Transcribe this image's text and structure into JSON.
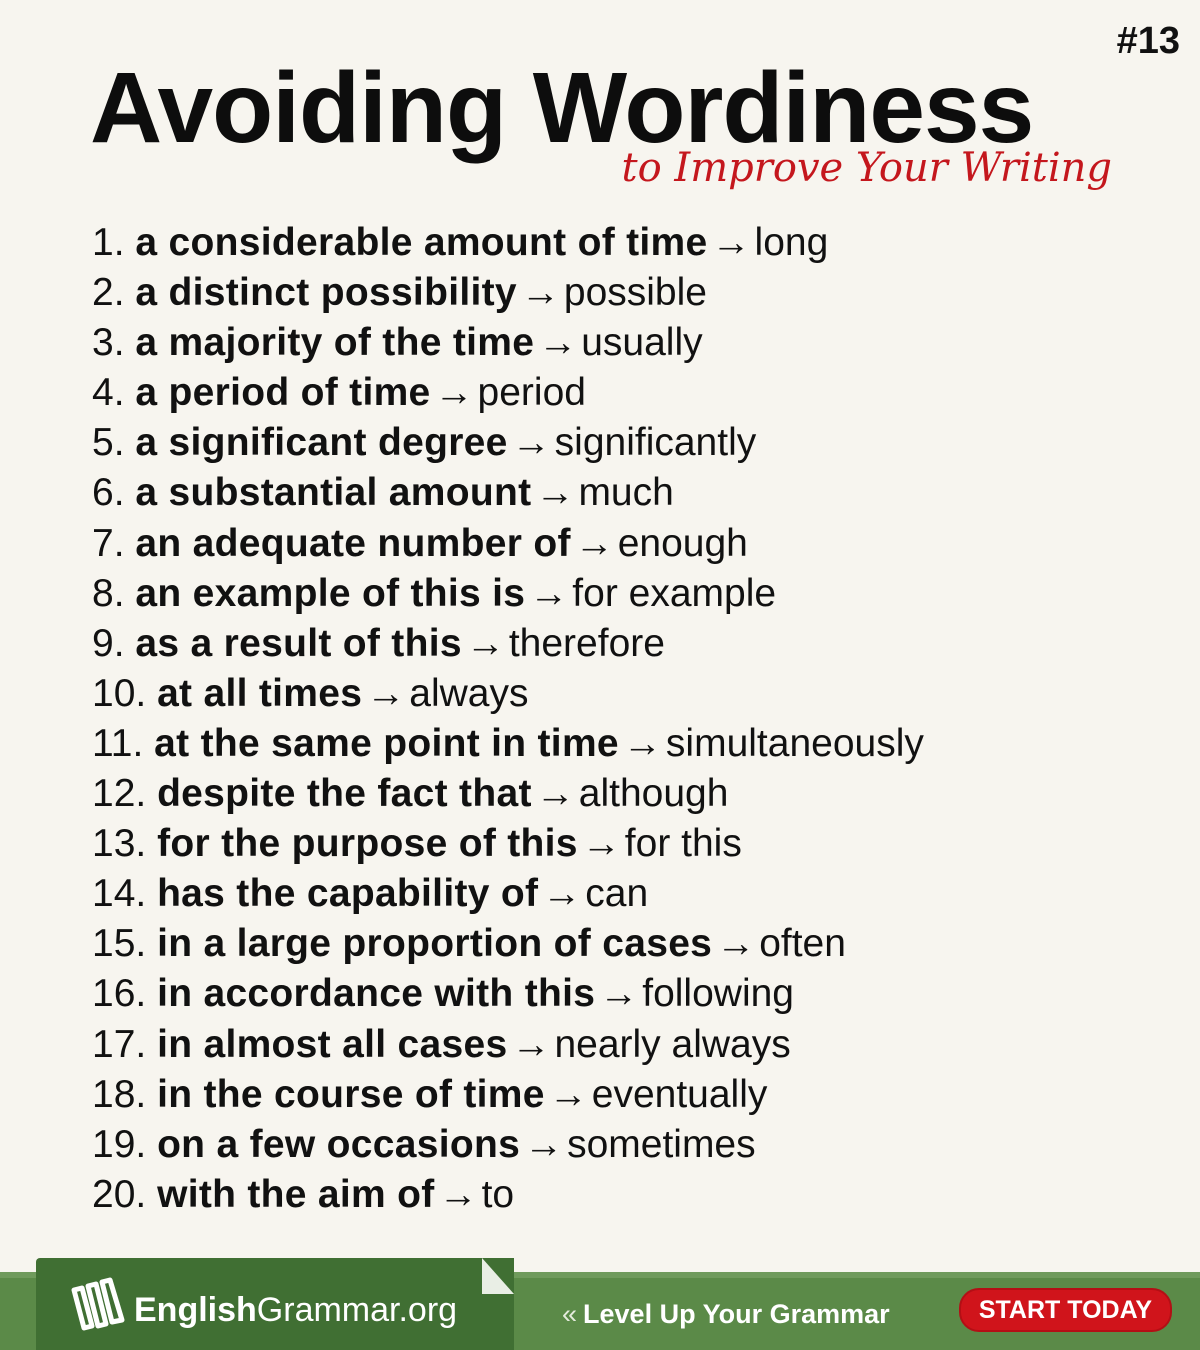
{
  "header": {
    "badge": "#13",
    "title": "Avoiding Wordiness",
    "subtitle": "to Improve Your Writing"
  },
  "arrow_symbol": "→",
  "items": [
    {
      "number": "1.",
      "phrase": "a considerable amount of time",
      "replacement": "long"
    },
    {
      "number": "2.",
      "phrase": "a distinct possibility",
      "replacement": "possible"
    },
    {
      "number": "3.",
      "phrase": "a majority of the time",
      "replacement": "usually"
    },
    {
      "number": "4.",
      "phrase": "a period of time",
      "replacement": "period"
    },
    {
      "number": "5.",
      "phrase": "a significant degree",
      "replacement": "significantly"
    },
    {
      "number": "6.",
      "phrase": "a substantial amount",
      "replacement": "much"
    },
    {
      "number": "7.",
      "phrase": "an adequate number of",
      "replacement": "enough"
    },
    {
      "number": "8.",
      "phrase": "an example of this is",
      "replacement": "for example"
    },
    {
      "number": "9.",
      "phrase": "as a result of this",
      "replacement": "therefore"
    },
    {
      "number": "10.",
      "phrase": "at all times",
      "replacement": "always"
    },
    {
      "number": "11.",
      "phrase": "at the same point in time",
      "replacement": "simultaneously"
    },
    {
      "number": "12.",
      "phrase": "despite the fact that",
      "replacement": "although"
    },
    {
      "number": "13.",
      "phrase": "for the purpose of this",
      "replacement": "for this"
    },
    {
      "number": "14.",
      "phrase": "has the capability of",
      "replacement": "can"
    },
    {
      "number": "15.",
      "phrase": "in a large proportion of cases",
      "replacement": "often"
    },
    {
      "number": "16.",
      "phrase": "in accordance with this",
      "replacement": "following"
    },
    {
      "number": "17.",
      "phrase": "in almost all cases",
      "replacement": "nearly always"
    },
    {
      "number": "18.",
      "phrase": "in the course of time",
      "replacement": "eventually"
    },
    {
      "number": "19.",
      "phrase": "on a few occasions",
      "replacement": "sometimes"
    },
    {
      "number": "20.",
      "phrase": "with the aim of",
      "replacement": "to"
    }
  ],
  "footer": {
    "logo_icon": "book-pages-icon",
    "logo_bold": "English",
    "logo_light": "Grammar.org",
    "tagline_icon": "double-chevron-left-icon",
    "tagline_chevron": "«",
    "tagline": "Level Up Your Grammar",
    "cta_label": "START TODAY",
    "colors": {
      "footer_green": "#5b8a48",
      "logo_green": "#406f33",
      "cta_red": "#d0141b",
      "subtitle_red": "#c4171d"
    }
  }
}
